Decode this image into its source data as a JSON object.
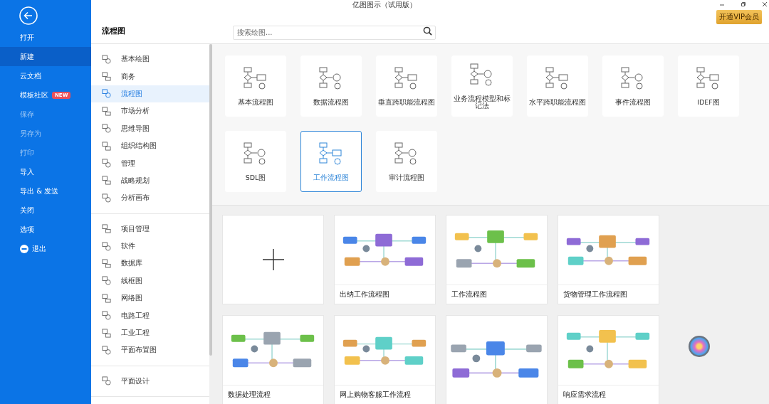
{
  "window": {
    "title": "亿图图示（试用版）"
  },
  "account": {
    "vip_button": "开通VIP会员"
  },
  "sidebar": {
    "items": [
      {
        "label": "打开",
        "kind": "item",
        "selected": false,
        "disabled": false
      },
      {
        "label": "新建",
        "kind": "item",
        "selected": true,
        "disabled": false
      },
      {
        "label": "云文档",
        "kind": "item",
        "selected": false,
        "disabled": false
      },
      {
        "label": "模板社区",
        "kind": "item",
        "selected": false,
        "disabled": false,
        "badge": "NEW"
      },
      {
        "label": "保存",
        "kind": "item",
        "selected": false,
        "disabled": true
      },
      {
        "label": "另存为",
        "kind": "item",
        "selected": false,
        "disabled": true
      },
      {
        "label": "打印",
        "kind": "item",
        "selected": false,
        "disabled": true
      },
      {
        "label": "导入",
        "kind": "item",
        "selected": false,
        "disabled": false
      },
      {
        "label": "导出 & 发送",
        "kind": "item",
        "selected": false,
        "disabled": false
      },
      {
        "label": "关闭",
        "kind": "item",
        "selected": false,
        "disabled": false
      },
      {
        "label": "选项",
        "kind": "item",
        "selected": false,
        "disabled": false
      },
      {
        "label": "退出",
        "kind": "exit",
        "selected": false,
        "disabled": false
      }
    ]
  },
  "category_panel": {
    "title": "流程图",
    "groups": [
      [
        {
          "label": "基本绘图",
          "selected": false
        },
        {
          "label": "商务",
          "selected": false
        },
        {
          "label": "流程图",
          "selected": true
        },
        {
          "label": "市场分析",
          "selected": false
        },
        {
          "label": "思维导图",
          "selected": false
        },
        {
          "label": "组织结构图",
          "selected": false
        },
        {
          "label": "管理",
          "selected": false
        },
        {
          "label": "战略规划",
          "selected": false
        },
        {
          "label": "分析画布",
          "selected": false
        }
      ],
      [
        {
          "label": "项目管理",
          "selected": false
        },
        {
          "label": "软件",
          "selected": false
        },
        {
          "label": "数据库",
          "selected": false
        },
        {
          "label": "线框图",
          "selected": false
        },
        {
          "label": "网络图",
          "selected": false
        },
        {
          "label": "电路工程",
          "selected": false
        },
        {
          "label": "工业工程",
          "selected": false
        },
        {
          "label": "平面布置图",
          "selected": false
        }
      ],
      [
        {
          "label": "平面设计",
          "selected": false
        }
      ]
    ]
  },
  "search": {
    "placeholder": "搜索绘图..."
  },
  "diagram_types": [
    {
      "label": "基本流程图",
      "selected": false
    },
    {
      "label": "数据流程图",
      "selected": false
    },
    {
      "label": "垂直跨职能流程图",
      "selected": false
    },
    {
      "label": "业务流程模型和标记法",
      "selected": false
    },
    {
      "label": "水平跨职能流程图",
      "selected": false
    },
    {
      "label": "事件流程图",
      "selected": false
    },
    {
      "label": "IDEF图",
      "selected": false
    },
    {
      "label": "SDL图",
      "selected": false
    },
    {
      "label": "工作流程图",
      "selected": true
    },
    {
      "label": "审计流程图",
      "selected": false
    }
  ],
  "templates": [
    {
      "kind": "blank"
    },
    {
      "kind": "template",
      "title": "出纳工作流程图"
    },
    {
      "kind": "template",
      "title": "工作流程图"
    },
    {
      "kind": "template",
      "title": "货物管理工作流程图"
    },
    {
      "kind": "template",
      "title": "数据处理流程"
    },
    {
      "kind": "template",
      "title": "网上购物客服工作流程"
    },
    {
      "kind": "template"
    },
    {
      "kind": "template",
      "title": "响应需求流程"
    }
  ]
}
